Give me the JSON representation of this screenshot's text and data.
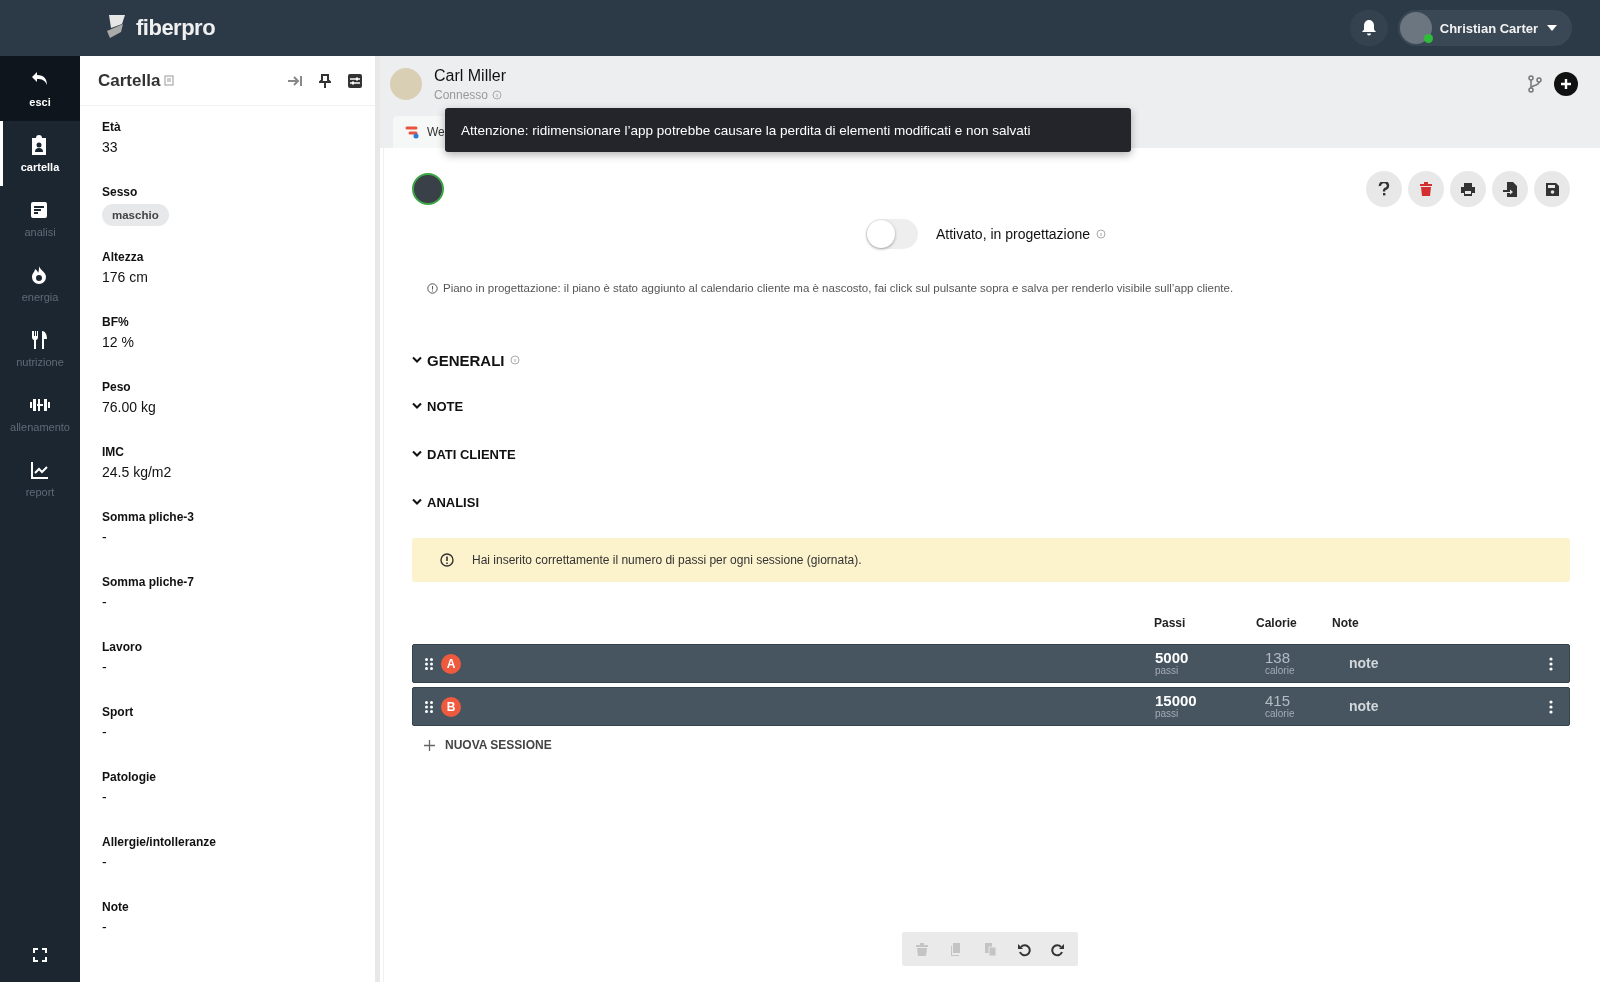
{
  "topbar": {
    "logo": "fiberpro",
    "user": {
      "name": "Christian Carter",
      "online": true
    }
  },
  "nav": [
    {
      "kind": "exit",
      "label": "esci",
      "selected": false
    },
    {
      "kind": "folder",
      "label": "cartella",
      "selected": true
    },
    {
      "kind": "analysis",
      "label": "analisi",
      "selected": false
    },
    {
      "kind": "energy",
      "label": "energia",
      "selected": false
    },
    {
      "kind": "nutrition",
      "label": "nutrizione",
      "selected": false
    },
    {
      "kind": "training",
      "label": "allenamento",
      "selected": false
    },
    {
      "kind": "report",
      "label": "report",
      "selected": false
    }
  ],
  "panel": {
    "title": "Cartella",
    "fields": [
      {
        "label": "Età",
        "value": "33"
      },
      {
        "label": "Sesso",
        "value": "maschio",
        "kind": "chip"
      },
      {
        "label": "Altezza",
        "value": "176 cm"
      },
      {
        "label": "BF%",
        "value": "12 %"
      },
      {
        "label": "Peso",
        "value": "76.00 kg"
      },
      {
        "label": "IMC",
        "value": "24.5 kg/m2"
      },
      {
        "label": "Somma pliche-3",
        "value": "-"
      },
      {
        "label": "Somma pliche-7",
        "value": "-"
      },
      {
        "label": "Lavoro",
        "value": "-"
      },
      {
        "label": "Sport",
        "value": "-"
      },
      {
        "label": "Patologie",
        "value": "-"
      },
      {
        "label": "Allergie/intolleranze",
        "value": "-"
      },
      {
        "label": "Note",
        "value": "-"
      }
    ]
  },
  "client": {
    "name": "Carl Miller",
    "status": "Connesso"
  },
  "tabs": [
    {
      "label": "We"
    }
  ],
  "tooltip": "Attenzione: ridimensionare l’app potrebbe causare la perdita di elementi modificati e non salvati",
  "toggle": {
    "on": false,
    "label": "Attivato, in progettazione"
  },
  "hint": "Piano in progettazione: il piano è stato aggiunto al calendario cliente ma è nascosto, fai click sul pulsante sopra e salva per renderlo visibile sull’app cliente.",
  "sections": [
    {
      "title": "GENERALI",
      "info": true
    },
    {
      "title": "NOTE",
      "info": false
    },
    {
      "title": "DATI CLIENTE",
      "info": false
    },
    {
      "title": "ANALISI",
      "info": false
    }
  ],
  "alert": "Hai inserito correttamente il numero di passi per ogni sessione (giornata).",
  "table": {
    "columns": [
      "Passi",
      "Calorie",
      "Note"
    ],
    "rows": [
      {
        "badge": "A",
        "steps": "5000",
        "steps_unit": "passi",
        "calories": "138",
        "calories_unit": "calorie",
        "note": "note"
      },
      {
        "badge": "B",
        "steps": "15000",
        "steps_unit": "passi",
        "calories": "415",
        "calories_unit": "calorie",
        "note": "note"
      }
    ]
  },
  "add_session": "NUOVA SESSIONE",
  "bottom_toolbar": [
    {
      "kind": "trash",
      "disabled": true
    },
    {
      "kind": "copy",
      "disabled": true
    },
    {
      "kind": "paste",
      "disabled": true
    },
    {
      "kind": "undo",
      "disabled": false
    },
    {
      "kind": "redo",
      "disabled": false
    }
  ]
}
